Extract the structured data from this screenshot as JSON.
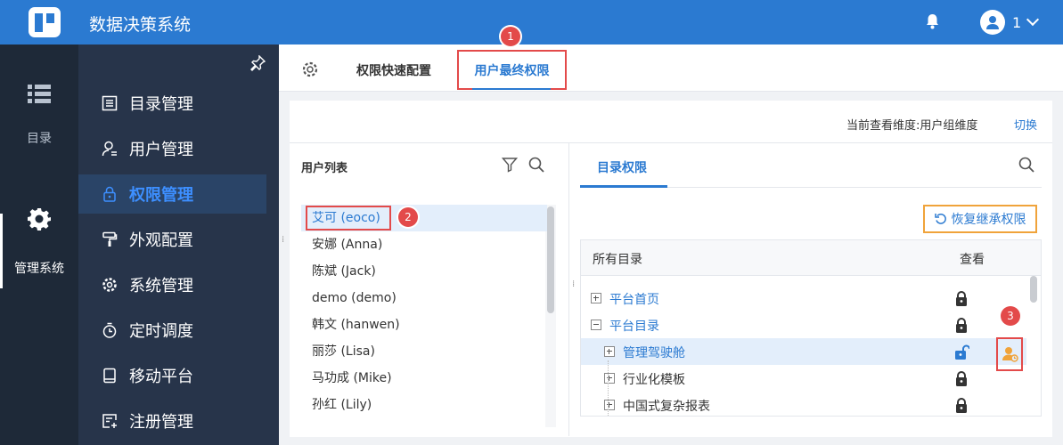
{
  "app": {
    "title": "数据决策系统",
    "user": "1"
  },
  "rail": {
    "items": [
      {
        "label": "目录"
      },
      {
        "label": "管理系统"
      }
    ]
  },
  "nav": {
    "items": [
      {
        "label": "目录管理"
      },
      {
        "label": "用户管理"
      },
      {
        "label": "权限管理"
      },
      {
        "label": "外观配置"
      },
      {
        "label": "系统管理"
      },
      {
        "label": "定时调度"
      },
      {
        "label": "移动平台"
      },
      {
        "label": "注册管理"
      }
    ],
    "active": "权限管理"
  },
  "tabs": {
    "quick": "权限快速配置",
    "final": "用户最终权限"
  },
  "badges": {
    "b1": "1",
    "b2": "2",
    "b3": "3"
  },
  "dimension": {
    "text": "当前查看维度:用户组维度",
    "switch": "切换"
  },
  "user_list": {
    "title": "用户列表",
    "users": [
      "艾可 (eoco)",
      "安娜 (Anna)",
      "陈斌 (Jack)",
      "demo (demo)",
      "韩文 (hanwen)",
      "丽莎 (Lisa)",
      "马功成 (Mike)",
      "孙红 (Lily)"
    ]
  },
  "right": {
    "tab": "目录权限",
    "restore": "恢复继承权限"
  },
  "tree": {
    "col_name": "所有目录",
    "col_view": "查看",
    "rows": [
      {
        "label": "平台首页"
      },
      {
        "label": "平台目录"
      },
      {
        "label": "管理驾驶舱"
      },
      {
        "label": "行业化模板"
      },
      {
        "label": "中国式复杂报表"
      }
    ]
  },
  "colors": {
    "primary": "#2b7ad1",
    "topbar": "#2b7ad1",
    "nav_bg": "#27344a",
    "rail_bg": "#1e2938",
    "highlight": "#e34a4a",
    "orange": "#f0a33a"
  }
}
